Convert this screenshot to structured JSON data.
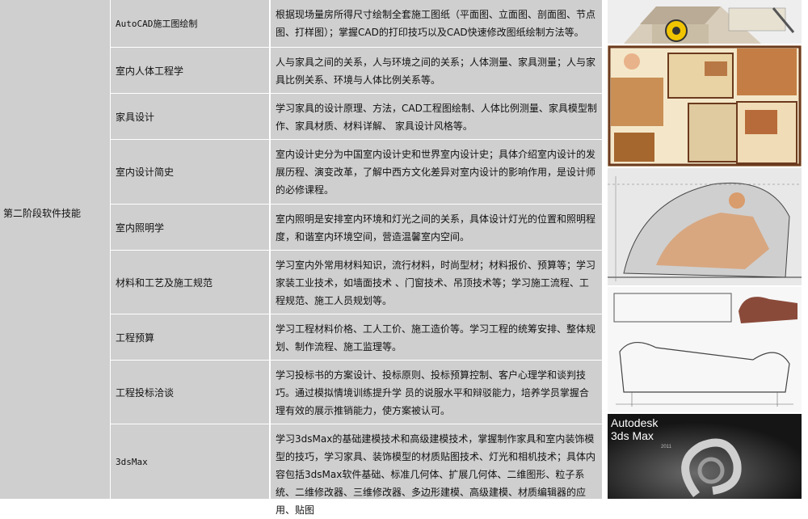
{
  "stage": {
    "label": "第二阶段软件技能"
  },
  "rows": [
    {
      "name": "AutoCAD施工图绘制",
      "desc": "根据现场量房所得尺寸绘制全套施工图纸（平面图、立面图、剖面图、节点图、打样图）；掌握CAD的打印技巧以及CAD快速修改图纸绘制方法等。"
    },
    {
      "name": "室内人体工程学",
      "desc": "人与家具之间的关系，人与环境之间的关系；人体测量、家具测量；人与家具比例关系、环境与人体比例关系等。"
    },
    {
      "name": "家具设计",
      "desc": "学习家具的设计原理、方法，CAD工程图绘制、人体比例测量、家具模型制作、家具材质、材料详解、 家具设计风格等。"
    },
    {
      "name": "室内设计简史",
      "desc": "室内设计史分为中国室内设计史和世界室内设计史；具体介绍室内设计的发展历程、演变改革，了解中西方文化差异对室内设计的影响作用，是设计师的必修课程。"
    },
    {
      "name": "室内照明学",
      "desc": "室内照明是安排室内环境和灯光之间的关系，具体设计灯光的位置和照明程度，和谐室内环境空间，营造温馨室内空间。"
    },
    {
      "name": "材料和工艺及施工规范",
      "desc": "学习室内外常用材料知识，流行材料，时尚型材；材料报价、预算等；学习家装工业技术，如墙面技术 、门窗技术、吊顶技术等；学习施工流程、工程规范、施工人员规划等。"
    },
    {
      "name": "工程预算",
      "desc": "学习工程材料价格、工人工价、施工造价等。学习工程的统筹安排、整体规划、制作流程、施工监理等。"
    },
    {
      "name": "工程投标洽谈",
      "desc": "学习投标书的方案设计、投标原则、投标预算控制、客户心理学和谈判技巧。通过模拟情境训练提升学 员的说服水平和辩驳能力，培养学员掌握合理有效的展示推销能力，使方案被认可。"
    },
    {
      "name": "3dsMax",
      "desc": "学习3dsMax的基础建模技术和高级建模技术，掌握制作家具和室内装饰模型的技巧，学习家具、装饰模型的材质贴图技术、灯光和相机技术；具体内容包括3dsMax软件基础、标准几何体、扩展几何体、二维图形、粒子系统、二维修改器、三维修改器、多边形建模、高级建模、材质编辑器的应用、贴图"
    }
  ],
  "images": {
    "max_brand": "Autodesk",
    "max_product": "3ds Max",
    "max_year": "2011"
  }
}
